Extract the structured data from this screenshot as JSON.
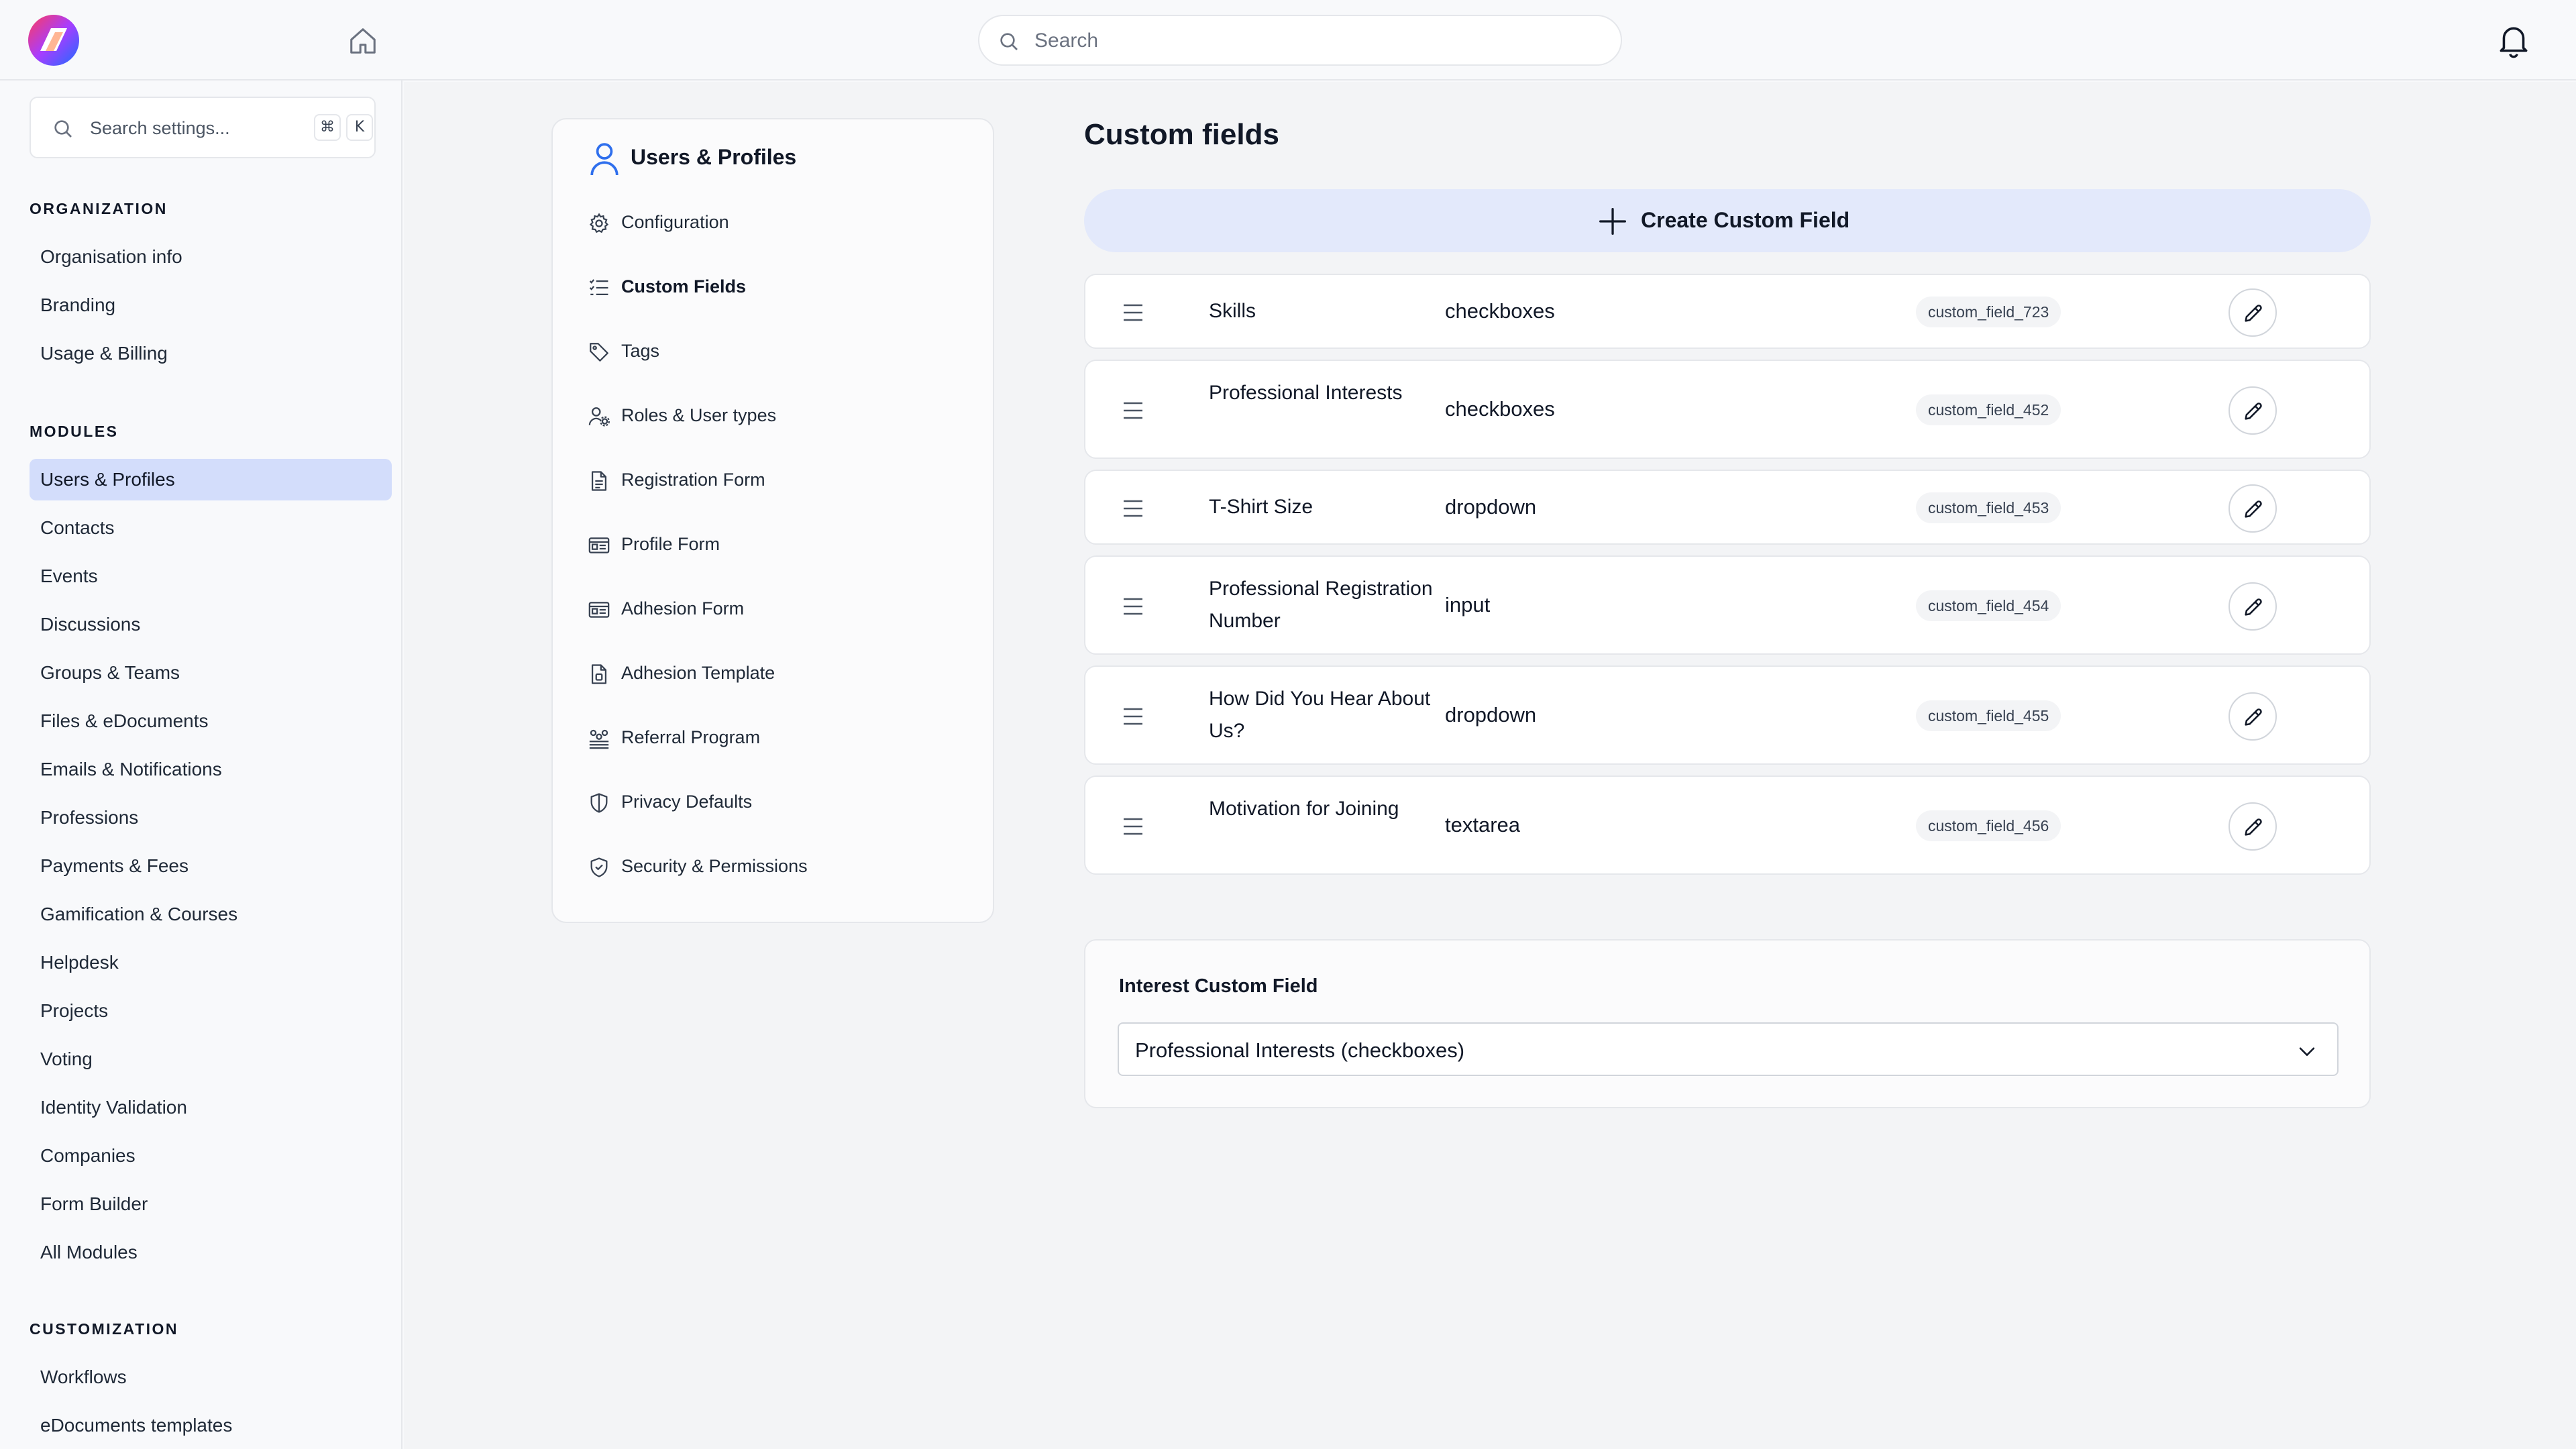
{
  "topbar": {
    "search_placeholder": "Search"
  },
  "sidebar": {
    "search_placeholder": "Search settings...",
    "shortcut_keys": [
      "⌘",
      "K"
    ],
    "sections": [
      {
        "title": "ORGANIZATION",
        "items": [
          "Organisation info",
          "Branding",
          "Usage & Billing"
        ]
      },
      {
        "title": "MODULES",
        "items": [
          "Users & Profiles",
          "Contacts",
          "Events",
          "Discussions",
          "Groups & Teams",
          "Files & eDocuments",
          "Emails & Notifications",
          "Professions",
          "Payments & Fees",
          "Gamification & Courses",
          "Helpdesk",
          "Projects",
          "Voting",
          "Identity Validation",
          "Companies",
          "Form Builder",
          "All Modules"
        ]
      },
      {
        "title": "CUSTOMIZATION",
        "items": [
          "Workflows",
          "eDocuments templates"
        ]
      }
    ],
    "active_item": "Users & Profiles"
  },
  "subnav": {
    "title": "Users & Profiles",
    "items": [
      {
        "label": "Configuration",
        "icon": "gear-icon"
      },
      {
        "label": "Custom Fields",
        "icon": "list-check-icon"
      },
      {
        "label": "Tags",
        "icon": "tag-icon"
      },
      {
        "label": "Roles & User types",
        "icon": "user-cog-icon"
      },
      {
        "label": "Registration Form",
        "icon": "document-icon"
      },
      {
        "label": "Profile Form",
        "icon": "id-card-icon"
      },
      {
        "label": "Adhesion Form",
        "icon": "id-card-icon"
      },
      {
        "label": "Adhesion Template",
        "icon": "document-template-icon"
      },
      {
        "label": "Referral Program",
        "icon": "referral-icon"
      },
      {
        "label": "Privacy Defaults",
        "icon": "shield-icon"
      },
      {
        "label": "Security & Permissions",
        "icon": "shield-check-icon"
      }
    ],
    "active_item": "Custom Fields"
  },
  "main": {
    "title": "Custom fields",
    "create_button": "Create Custom Field",
    "fields": [
      {
        "name": "Skills",
        "type": "checkboxes",
        "key": "custom_field_723"
      },
      {
        "name": "Professional Interests",
        "type": "checkboxes",
        "key": "custom_field_452"
      },
      {
        "name": "T-Shirt Size",
        "type": "dropdown",
        "key": "custom_field_453"
      },
      {
        "name": "Professional Registration Number",
        "type": "input",
        "key": "custom_field_454"
      },
      {
        "name": "How Did You Hear About Us?",
        "type": "dropdown",
        "key": "custom_field_455"
      },
      {
        "name": "Motivation for Joining",
        "type": "textarea",
        "key": "custom_field_456"
      }
    ],
    "interest": {
      "label": "Interest Custom Field",
      "selected": "Professional Interests (checkboxes)"
    }
  },
  "colors": {
    "active_nav_bg": "#d3ddfb",
    "create_button_bg": "#e3e9fb",
    "page_bg": "#f3f4f6"
  }
}
